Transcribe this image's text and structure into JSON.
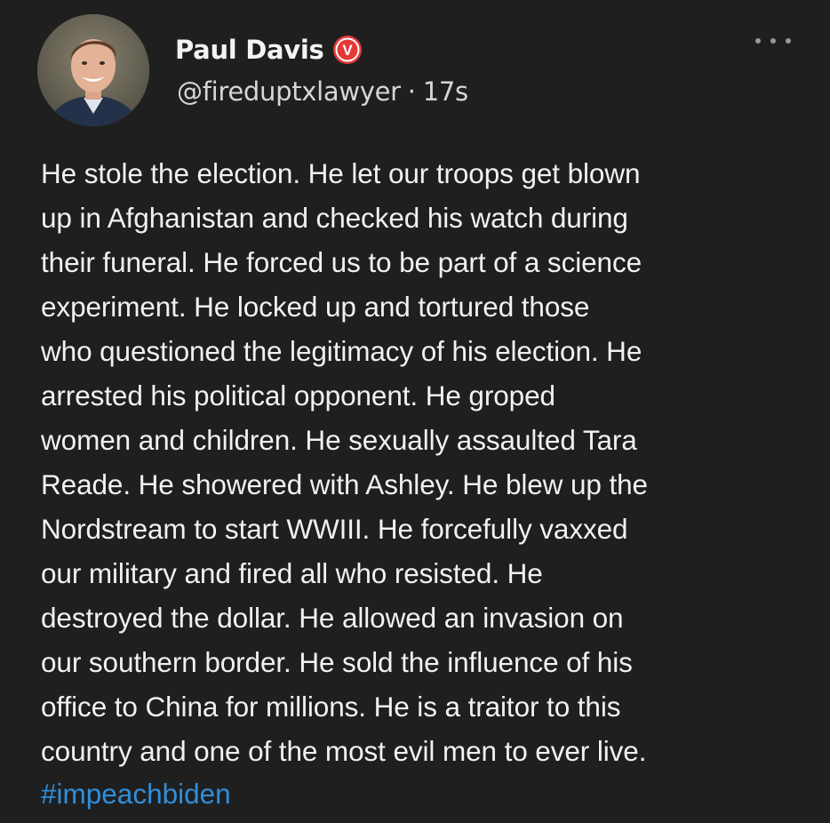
{
  "post": {
    "author": {
      "name": "Paul Davis",
      "handle": "@fireduptxlawyer",
      "separator": "·",
      "time": "17s",
      "verified_badge": "V",
      "verified_color": "#e53935"
    },
    "menu_icon": "more-horizontal-icon",
    "text": "He stole the election. He let our troops get blown\nup in Afghanistan and checked his watch during\ntheir funeral. He forced us to be part of a science\nexperiment. He locked up and tortured those\nwho questioned the legitimacy of his election. He\narrested his political opponent. He groped\nwomen and children. He sexually assaulted Tara\nReade. He showered with Ashley. He blew up the\nNordstream to start WWIII. He forcefully vaxxed\nour military and fired all who resisted. He\ndestroyed the dollar. He allowed an invasion on\nour southern border. He sold the influence of his\noffice to China for millions. He is a traitor to this\ncountry and one of the most evil men to ever live.",
    "hashtag": "#impeachbiden",
    "colors": {
      "background": "#1f1f1f",
      "text": "#f1f1f1",
      "hashtag": "#2f8fdc"
    }
  }
}
